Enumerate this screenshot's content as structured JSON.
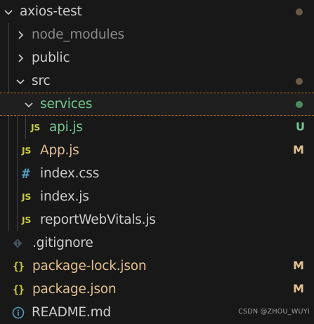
{
  "explorer": {
    "items": [
      {
        "name": "axios-test",
        "type": "folder",
        "expanded": true,
        "decoration": "dot",
        "decoration_color": "#6b5a45"
      },
      {
        "name": "node_modules",
        "type": "folder",
        "expanded": false,
        "dimmed": true
      },
      {
        "name": "public",
        "type": "folder",
        "expanded": false
      },
      {
        "name": "src",
        "type": "folder",
        "expanded": true,
        "decoration": "dot",
        "decoration_color": "#6b5a45"
      },
      {
        "name": "services",
        "type": "folder",
        "expanded": true,
        "selected": true,
        "status": "untracked",
        "decoration": "dot",
        "decoration_color": "#4f8a5e"
      },
      {
        "name": "api.js",
        "type": "file",
        "icon": "js-file-icon",
        "icon_text": "JS",
        "status": "untracked",
        "badge": "U",
        "badge_color": "#73c991"
      },
      {
        "name": "App.js",
        "type": "file",
        "icon": "js-file-icon",
        "icon_text": "JS",
        "status": "modified",
        "badge": "M",
        "badge_color": "#e2c08d"
      },
      {
        "name": "index.css",
        "type": "file",
        "icon": "css-file-icon",
        "icon_text": "#"
      },
      {
        "name": "index.js",
        "type": "file",
        "icon": "js-file-icon",
        "icon_text": "JS"
      },
      {
        "name": "reportWebVitals.js",
        "type": "file",
        "icon": "js-file-icon",
        "icon_text": "JS"
      },
      {
        "name": ".gitignore",
        "type": "file",
        "icon": "git-file-icon"
      },
      {
        "name": "package-lock.json",
        "type": "file",
        "icon": "json-file-icon",
        "icon_text": "{}",
        "status": "modified",
        "badge": "M",
        "badge_color": "#e2c08d"
      },
      {
        "name": "package.json",
        "type": "file",
        "icon": "json-file-icon",
        "icon_text": "{}",
        "status": "modified",
        "badge": "M",
        "badge_color": "#e2c08d"
      },
      {
        "name": "README.md",
        "type": "file",
        "icon": "info-file-icon"
      }
    ]
  },
  "watermark": "CSDN @ZHOU_WUYI"
}
